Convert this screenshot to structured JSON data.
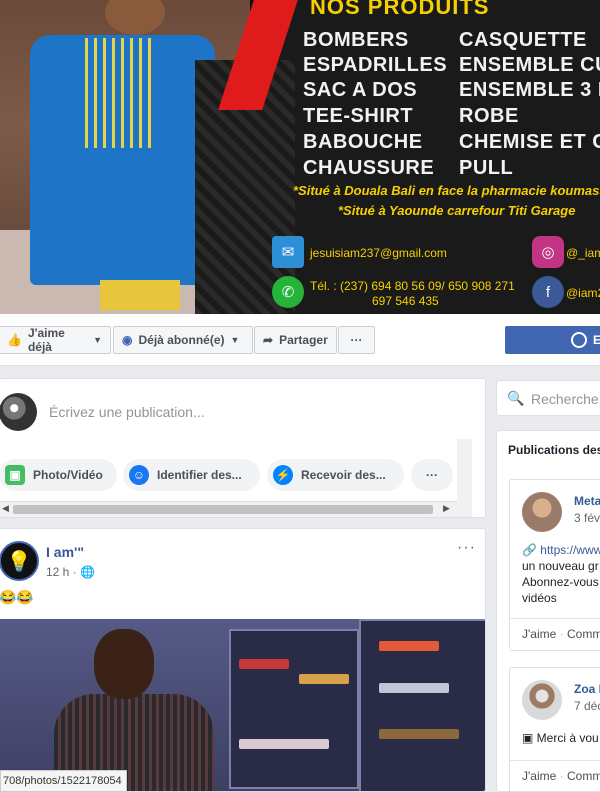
{
  "cover": {
    "heading": "NOS PRODUITS",
    "products_left": [
      "BOMBERS",
      "ESPADRILLES",
      "SAC A DOS",
      "TEE-SHIRT",
      "BABOUCHE",
      "CHAUSSURE"
    ],
    "products_right": [
      "CASQUETTE",
      "ENSEMBLE CU",
      "ENSEMBLE 3 P",
      "ROBE",
      "CHEMISE ET C",
      "PULL"
    ],
    "location1": "*Situé à Douala Bali en face la pharmacie koumass",
    "location2": "*Situé à Yaounde carrefour Titi Garage",
    "email": "jesuisiam237@gmail.com",
    "phone_line1": "Tél. : (237) 694 80 56 09/ 650 908 271",
    "phone_line2": "697 546 435",
    "instagram": "@_iam",
    "facebook": "@iam2"
  },
  "actions": {
    "like": "J'aime déjà",
    "follow": "Déjà abonné(e)",
    "share": "Partager",
    "more": "···",
    "message": "E"
  },
  "composer": {
    "placeholder": "Écrivez une publication...",
    "chips": [
      "Photo/Vidéo",
      "Identifier des...",
      "Recevoir des...",
      "···"
    ]
  },
  "post": {
    "author": "I am'\"",
    "time": "12 h ·",
    "text": "😂😂",
    "more": "···"
  },
  "status_url": "708/photos/1522178054",
  "sidebar": {
    "search_placeholder": "Recherche",
    "section_title": "Publications des",
    "items": [
      {
        "name": "Meta",
        "date": "3 févr",
        "lines": [
          "🔗 https://www",
          "un nouveau gr",
          "Abonnez-vous",
          "vidéos"
        ],
        "like": "J'aime",
        "comment": "Comm"
      },
      {
        "name": "Zoa I",
        "date": "7 déc",
        "lines": [
          "▣ Merci à vou"
        ],
        "like": "J'aime",
        "comment": "Comm"
      }
    ]
  }
}
